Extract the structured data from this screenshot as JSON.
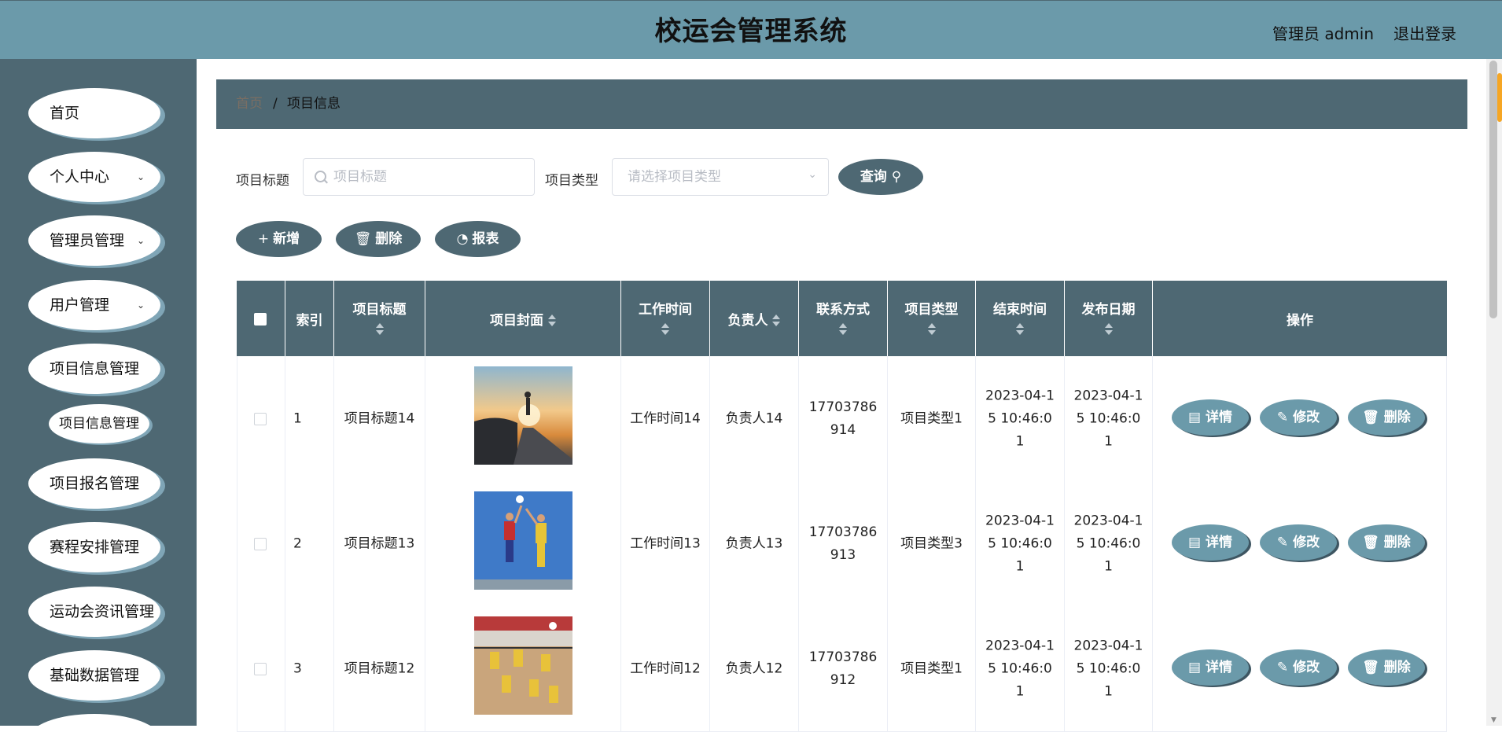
{
  "header": {
    "title": "校运会管理系统",
    "admin": "管理员 admin",
    "logout": "退出登录"
  },
  "sidebar": {
    "items": [
      {
        "label": "首页"
      },
      {
        "label": "个人中心"
      },
      {
        "label": "管理员管理"
      },
      {
        "label": "用户管理"
      },
      {
        "label": "项目信息管理"
      },
      {
        "label": "项目信息管理"
      },
      {
        "label": "项目报名管理"
      },
      {
        "label": "赛程安排管理"
      },
      {
        "label": "运动会资讯管理"
      },
      {
        "label": "基础数据管理"
      }
    ]
  },
  "breadcrumb": {
    "home": "首页",
    "separator": "/",
    "current": "项目信息"
  },
  "search": {
    "title_label": "项目标题",
    "title_placeholder": "项目标题",
    "type_label": "项目类型",
    "type_placeholder": "请选择项目类型",
    "query_button": "查询"
  },
  "toolbar": {
    "add": "新增",
    "delete": "删除",
    "report": "报表"
  },
  "table": {
    "headers": {
      "index": "索引",
      "title": "项目标题",
      "cover": "项目封面",
      "work_time": "工作时间",
      "owner": "负责人",
      "contact": "联系方式",
      "type": "项目类型",
      "end_time": "结束时间",
      "publish_date": "发布日期",
      "actions": "操作"
    },
    "rows": [
      {
        "index": "1",
        "title": "项目标题14",
        "work_time": "工作时间14",
        "owner": "负责人14",
        "contact": "17703786914",
        "type": "项目类型1",
        "end_time": "2023-04-15 10:46:01",
        "publish_date": "2023-04-15 10:46:01"
      },
      {
        "index": "2",
        "title": "项目标题13",
        "work_time": "工作时间13",
        "owner": "负责人13",
        "contact": "17703786913",
        "type": "项目类型3",
        "end_time": "2023-04-15 10:46:01",
        "publish_date": "2023-04-15 10:46:01"
      },
      {
        "index": "3",
        "title": "项目标题12",
        "work_time": "工作时间12",
        "owner": "负责人12",
        "contact": "17703786912",
        "type": "项目类型1",
        "end_time": "2023-04-15 10:46:01",
        "publish_date": "2023-04-15 10:46:01"
      }
    ],
    "actions": {
      "detail": "详情",
      "edit": "修改",
      "delete": "删除"
    }
  },
  "colors": {
    "header": "#6b9aaa",
    "sidebar": "#4e6873",
    "button": "#4e6873",
    "action_button": "#6b9aaa"
  }
}
